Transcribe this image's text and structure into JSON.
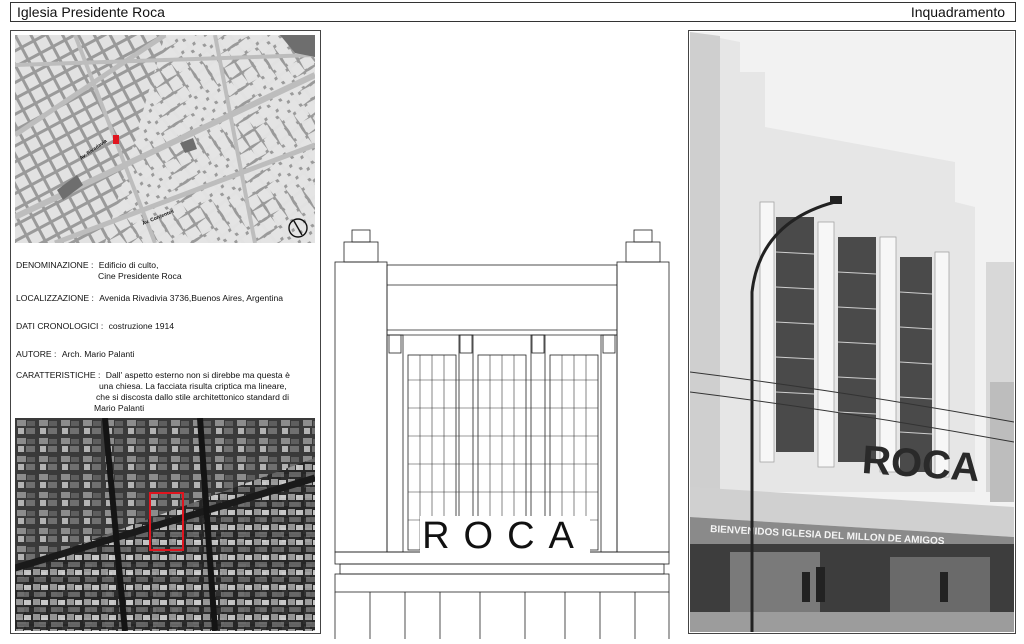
{
  "header": {
    "title": "Iglesia Presidente Roca",
    "section": "Inquadramento"
  },
  "map": {
    "street_label_1": "Av. Rivadavia",
    "street_label_2": "Av. Corrientes",
    "north_icon": "compass-north-icon",
    "colors": {
      "background": "#9a9a9a",
      "block": "#e2e2e2",
      "avenue": "#bdbdbd",
      "marker": "#e0141e",
      "park": "#6e6e6e"
    }
  },
  "info": {
    "denominazione_label": "DENOMINAZIONE :",
    "denominazione_value_1": "Edificio di culto,",
    "denominazione_value_2": "Cine Presidente Roca",
    "localizzazione_label": "LOCALIZZAZIONE :",
    "localizzazione_value": "Avenida Rivadivia 3736,Buenos Aires, Argentina",
    "dati_label": "DATI CRONOLOGICI :",
    "dati_value": "costruzione 1914",
    "autore_label": "AUTORE :",
    "autore_value": "Arch. Mario Palanti",
    "caratteristiche_label": "CARATTERISTICHE :",
    "caratteristiche_line_1": "Dall' aspetto esterno non si direbbe ma questa è",
    "caratteristiche_line_2": "una chiesa. La facciata risulta criptica ma lineare,",
    "caratteristiche_line_3": "che si discosta dallo stile architettonico standard di",
    "caratteristiche_line_4": "Mario Palanti"
  },
  "elevation": {
    "sign": "ROCA"
  },
  "photo": {
    "sign": "ROCA",
    "banner": "BIENVENIDOS  IGLESIA DEL MILLON DE AMIGOS"
  }
}
